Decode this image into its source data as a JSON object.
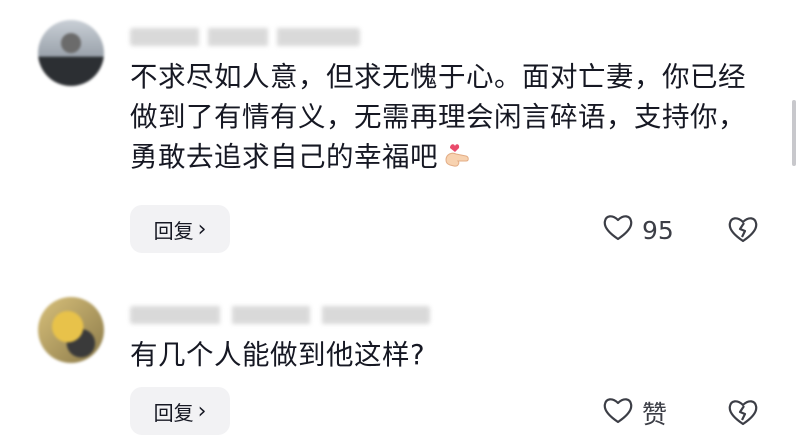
{
  "comments": [
    {
      "text": "不求尽如人意，但求无愧于心。面对亡妻，你已经做到了有情有义，无需再理会闲言碎语，支持你，勇敢去追求自己的幸福吧",
      "emoji_icon": "finger-heart-icon",
      "reply_label": "回复",
      "like_count": "95"
    },
    {
      "text": "有几个人能做到他这样?",
      "reply_label": "回复",
      "like_count": "赞"
    }
  ]
}
